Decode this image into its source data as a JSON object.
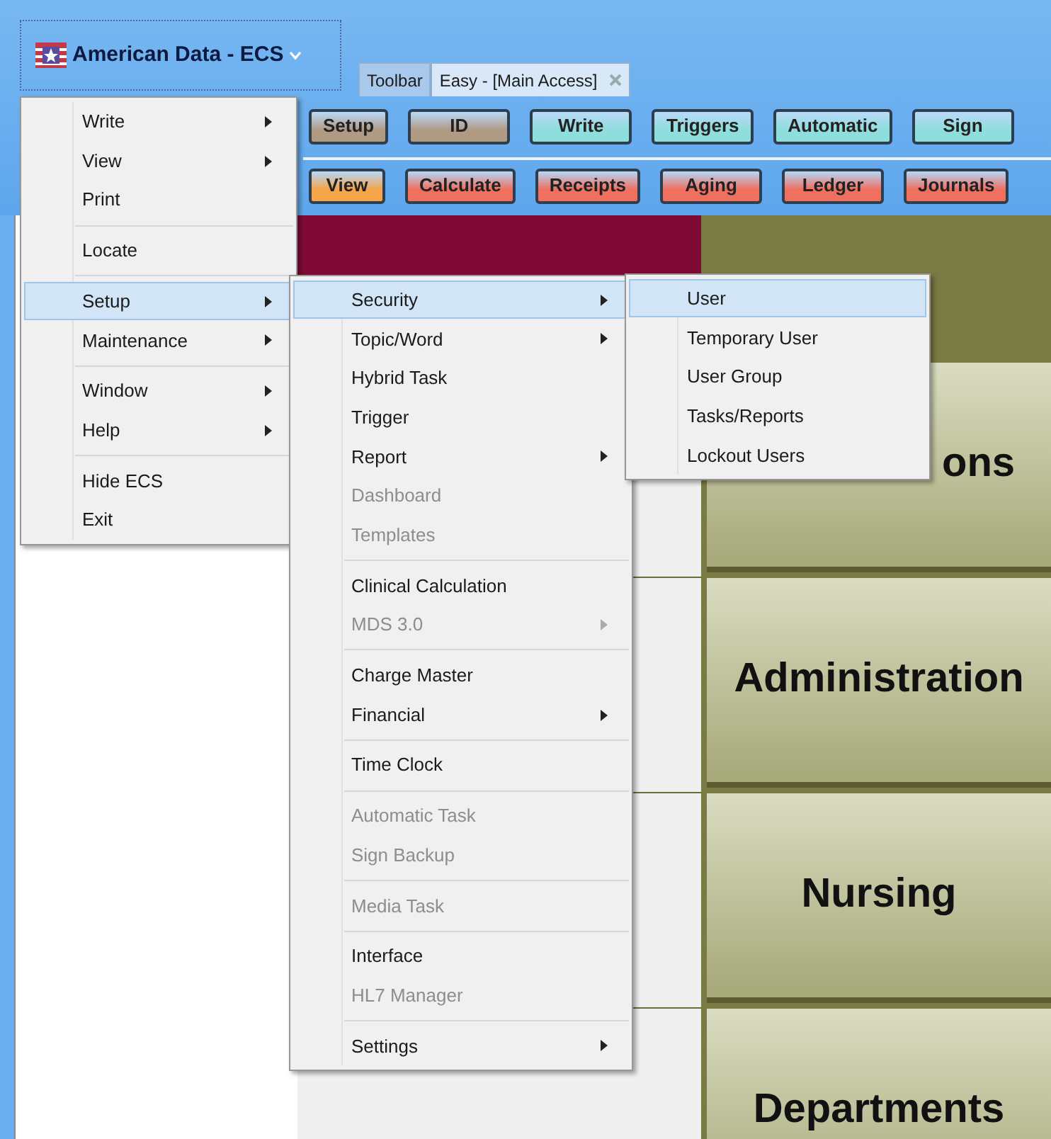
{
  "app_title": "American Data - ECS",
  "tabs": [
    {
      "label": "Toolbar",
      "selected": false,
      "closable": false
    },
    {
      "label": "Easy - [Main Access]",
      "selected": true,
      "closable": true
    }
  ],
  "toolbar_rows": [
    [
      {
        "label": "Setup",
        "color": "#b09a84"
      },
      {
        "label": "ID",
        "color": "#b09a84"
      },
      {
        "label": "Write",
        "color": "#8fdede"
      },
      {
        "label": "Triggers",
        "color": "#8fdede"
      },
      {
        "label": "Automatic",
        "color": "#8fdede"
      },
      {
        "label": "Sign",
        "color": "#8fdede"
      }
    ],
    [
      {
        "label": "View",
        "color": "#f5a54a"
      },
      {
        "label": "Calculate",
        "color": "#f07060"
      },
      {
        "label": "Receipts",
        "color": "#f07060"
      },
      {
        "label": "Aging",
        "color": "#f07060"
      },
      {
        "label": "Ledger",
        "color": "#f07060"
      },
      {
        "label": "Journals",
        "color": "#f07060"
      }
    ]
  ],
  "tiles": [
    {
      "label": "ons"
    },
    {
      "label": "Administration"
    },
    {
      "label": "Nursing"
    },
    {
      "label": "Departments"
    }
  ],
  "menu": {
    "groups": [
      [
        {
          "label": "Write",
          "submenu": true,
          "disabled": false,
          "selected": false
        },
        {
          "label": "View",
          "submenu": true,
          "disabled": false,
          "selected": false
        },
        {
          "label": "Print",
          "submenu": false,
          "disabled": false,
          "selected": false
        }
      ],
      [
        {
          "label": "Locate",
          "submenu": false,
          "disabled": false,
          "selected": false
        }
      ],
      [
        {
          "label": "Setup",
          "submenu": true,
          "disabled": false,
          "selected": true,
          "children": [
            [
              {
                "label": "Security",
                "submenu": true,
                "disabled": false,
                "selected": true,
                "children": [
                  [
                    {
                      "label": "User",
                      "submenu": false,
                      "disabled": false,
                      "selected": true
                    },
                    {
                      "label": "Temporary User",
                      "submenu": false,
                      "disabled": false,
                      "selected": false
                    },
                    {
                      "label": "User Group",
                      "submenu": false,
                      "disabled": false,
                      "selected": false
                    },
                    {
                      "label": "Tasks/Reports",
                      "submenu": false,
                      "disabled": false,
                      "selected": false
                    },
                    {
                      "label": "Lockout Users",
                      "submenu": false,
                      "disabled": false,
                      "selected": false
                    }
                  ]
                ]
              },
              {
                "label": "Topic/Word",
                "submenu": true,
                "disabled": false,
                "selected": false
              },
              {
                "label": "Hybrid Task",
                "submenu": false,
                "disabled": false,
                "selected": false
              },
              {
                "label": "Trigger",
                "submenu": false,
                "disabled": false,
                "selected": false
              },
              {
                "label": "Report",
                "submenu": true,
                "disabled": false,
                "selected": false
              },
              {
                "label": "Dashboard",
                "submenu": false,
                "disabled": true,
                "selected": false
              },
              {
                "label": "Templates",
                "submenu": false,
                "disabled": true,
                "selected": false
              }
            ],
            [
              {
                "label": "Clinical Calculation",
                "submenu": false,
                "disabled": false,
                "selected": false
              },
              {
                "label": "MDS 3.0",
                "submenu": true,
                "disabled": true,
                "selected": false
              }
            ],
            [
              {
                "label": "Charge Master",
                "submenu": false,
                "disabled": false,
                "selected": false
              },
              {
                "label": "Financial",
                "submenu": true,
                "disabled": false,
                "selected": false
              }
            ],
            [
              {
                "label": "Time Clock",
                "submenu": false,
                "disabled": false,
                "selected": false
              }
            ],
            [
              {
                "label": "Automatic Task",
                "submenu": false,
                "disabled": true,
                "selected": false
              },
              {
                "label": "Sign Backup",
                "submenu": false,
                "disabled": true,
                "selected": false
              }
            ],
            [
              {
                "label": "Media Task",
                "submenu": false,
                "disabled": true,
                "selected": false
              }
            ],
            [
              {
                "label": "Interface",
                "submenu": false,
                "disabled": false,
                "selected": false
              },
              {
                "label": "HL7 Manager",
                "submenu": false,
                "disabled": true,
                "selected": false
              }
            ],
            [
              {
                "label": "Settings",
                "submenu": true,
                "disabled": false,
                "selected": false
              }
            ]
          ]
        },
        {
          "label": "Maintenance",
          "submenu": true,
          "disabled": false,
          "selected": false
        }
      ],
      [
        {
          "label": "Window",
          "submenu": true,
          "disabled": false,
          "selected": false
        },
        {
          "label": "Help",
          "submenu": true,
          "disabled": false,
          "selected": false
        }
      ],
      [
        {
          "label": "Hide ECS",
          "submenu": false,
          "disabled": false,
          "selected": false
        },
        {
          "label": "Exit",
          "submenu": false,
          "disabled": false,
          "selected": false
        }
      ]
    ]
  }
}
